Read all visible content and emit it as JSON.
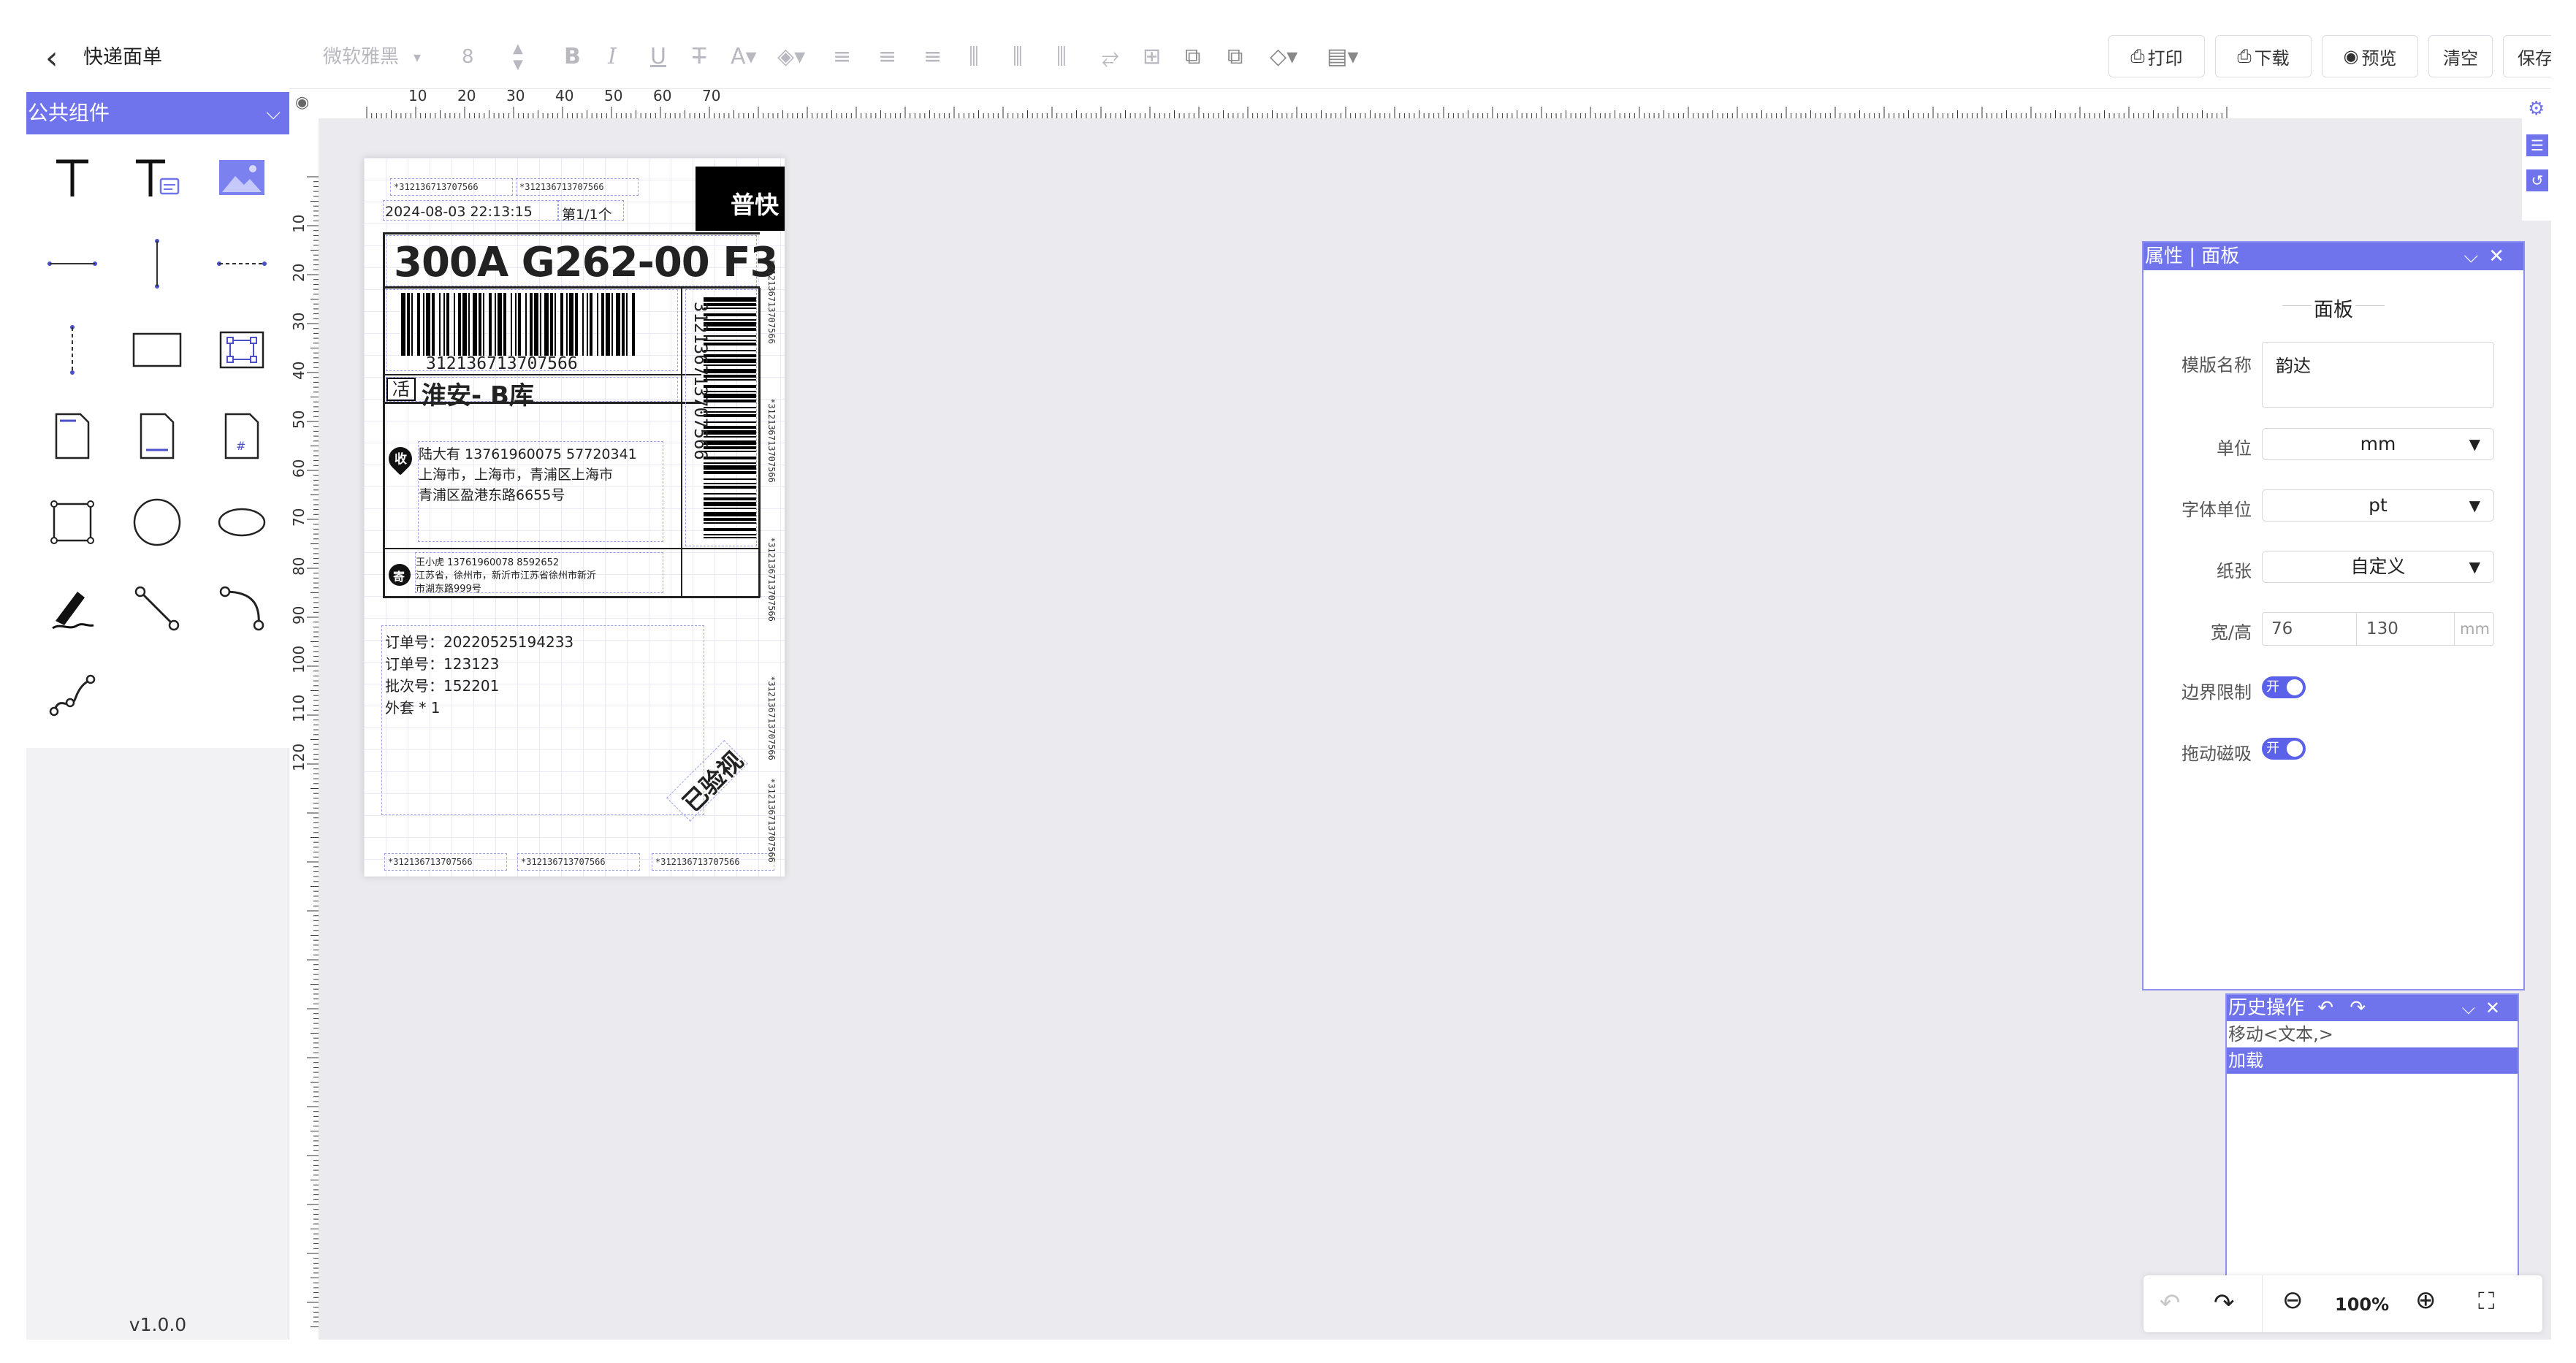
{
  "app": {
    "title": "快递面单",
    "version": "v1.0.0"
  },
  "sidebar": {
    "section_title": "公共组件"
  },
  "toolbar": {
    "font_family": "微软雅黑",
    "font_size": "8",
    "buttons": {
      "print": "打印",
      "download": "下载",
      "preview": "预览",
      "clear": "清空",
      "save": "保存"
    }
  },
  "ruler": {
    "top_labels": [
      "10",
      "20",
      "30",
      "40",
      "50",
      "60",
      "70"
    ],
    "left_labels": [
      "10",
      "20",
      "30",
      "40",
      "50",
      "60",
      "70",
      "80",
      "90",
      "100",
      "110",
      "120"
    ]
  },
  "label": {
    "tracking_small": "*312136713707566",
    "datetime": "2024-08-03 22:13:15",
    "page": "第1/1个",
    "express_type": "普快",
    "route_code": "300A G262-00 F3",
    "barcode_number": "312136713707566",
    "dest_icon": "㓉",
    "dest_text": "淮安- B库",
    "recv_badge": "收",
    "recv_line1": "陆大有 13761960075 57720341",
    "recv_line2": "上海市，上海市，青浦区上海市",
    "recv_line3": "青浦区盈港东路6655号",
    "send_badge": "寄",
    "send_line1": "王小虎 13761960078 8592652",
    "send_line2": "江苏省，徐州市，新沂市江苏省徐州市新沂",
    "send_line3": "市湖东路999号",
    "order1": "订单号：20220525194233",
    "order2": "订单号：123123",
    "batch": "批次号：152201",
    "package": "外套 * 1",
    "stamp": "已验视"
  },
  "props_panel": {
    "title": "属性 | 面板",
    "section": "面板",
    "fields": {
      "template_name_label": "模版名称",
      "template_name_value": "韵达",
      "unit_label": "单位",
      "unit_value": "mm",
      "font_unit_label": "字体单位",
      "font_unit_value": "pt",
      "paper_label": "纸张",
      "paper_value": "自定义",
      "size_label": "宽/高",
      "width": "76",
      "height": "130",
      "size_unit": "mm",
      "boundary_label": "边界限制",
      "boundary_value": "开",
      "snap_label": "拖动磁吸",
      "snap_value": "开"
    }
  },
  "history": {
    "title": "历史操作",
    "items": [
      "移动<文本,>",
      "加载"
    ],
    "active_index": 1
  },
  "zoom": {
    "level": "100%"
  },
  "colors": {
    "accent": "#6f74ec",
    "canvas": "#ebebef"
  }
}
